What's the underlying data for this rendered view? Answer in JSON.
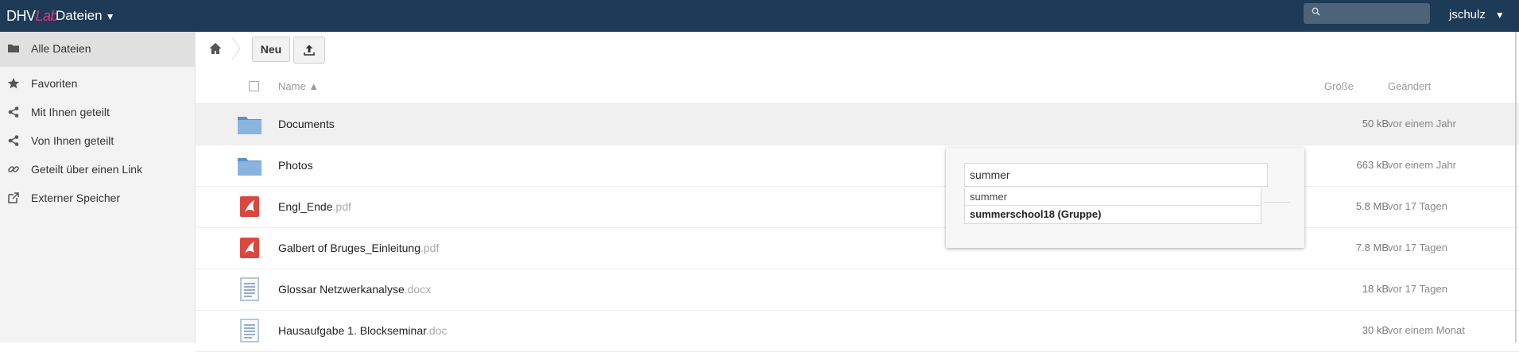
{
  "header": {
    "logo_main": "DHV",
    "logo_accent": "Lab",
    "app_title": "Dateien",
    "search_placeholder": "",
    "user": "jschulz"
  },
  "sidebar": {
    "items": [
      {
        "label": "Alle Dateien",
        "icon": "folder-icon"
      },
      {
        "label": "Favoriten",
        "icon": "star-icon"
      },
      {
        "label": "Mit Ihnen geteilt",
        "icon": "share-icon"
      },
      {
        "label": "Von Ihnen geteilt",
        "icon": "share-icon"
      },
      {
        "label": "Geteilt über einen Link",
        "icon": "link-icon"
      },
      {
        "label": "Externer Speicher",
        "icon": "external-storage-icon"
      }
    ]
  },
  "controls": {
    "new_label": "Neu"
  },
  "table": {
    "col_name": "Name ▲",
    "col_size": "Größe",
    "col_modified": "Geändert",
    "rows": [
      {
        "name": "Documents",
        "ext": "",
        "size": "50 kB",
        "modified": "vor einem Jahr",
        "type": "folder"
      },
      {
        "name": "Photos",
        "ext": "",
        "size": "663 kB",
        "modified": "vor einem Jahr",
        "type": "folder"
      },
      {
        "name": "Engl_Ende",
        "ext": ".pdf",
        "size": "5.8 MB",
        "modified": "vor 17 Tagen",
        "type": "pdf"
      },
      {
        "name": "Galbert of Bruges_Einleitung",
        "ext": ".pdf",
        "size": "7.8 MB",
        "modified": "vor 17 Tagen",
        "type": "pdf"
      },
      {
        "name": "Glossar Netzwerkanalyse",
        "ext": ".docx",
        "size": "18 kB",
        "modified": "vor 17 Tagen",
        "type": "document"
      },
      {
        "name": "Hausaufgabe 1. Blockseminar",
        "ext": ".doc",
        "size": "30 kB",
        "modified": "vor einem Monat",
        "type": "document"
      }
    ]
  },
  "share_popover": {
    "input_value": "summer",
    "suggestions": [
      "summer",
      "summerschool18 (Gruppe)"
    ]
  },
  "colors": {
    "header_bg": "#1d3a57",
    "logo_accent": "#e0397e",
    "folder_blue": "#7ba5d4",
    "pdf_red": "#d9473f"
  }
}
